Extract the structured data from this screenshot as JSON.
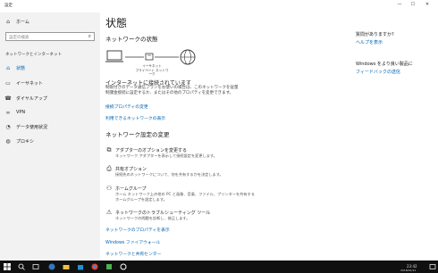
{
  "window": {
    "title": "設定",
    "min": "—",
    "max": "☐",
    "close": "✕"
  },
  "sidebar": {
    "home": "ホーム",
    "search_placeholder": "設定の検索",
    "section": "ネットワークとインターネット",
    "items": [
      {
        "label": "状態",
        "icon": "home-globe-icon"
      },
      {
        "label": "イーサネット",
        "icon": "ethernet-icon"
      },
      {
        "label": "ダイヤルアップ",
        "icon": "phone-icon"
      },
      {
        "label": "VPN",
        "icon": "vpn-icon"
      },
      {
        "label": "データ使用状況",
        "icon": "data-usage-icon"
      },
      {
        "label": "プロキシ",
        "icon": "globe-icon"
      }
    ]
  },
  "main": {
    "title": "状態",
    "network_status_heading": "ネットワークの状態",
    "diagram_label1": "イーサネット",
    "diagram_label2": "プライベート ネットワーク",
    "connected_heading": "インターネットに接続されています",
    "connected_desc1": "制限付きのデータ通信プランをお使いの場合は、このネットワークを従量",
    "connected_desc2": "制課金接続に設定するか、またはその他のプロパティを変更できます。",
    "link_change_props": "接続プロパティの変更",
    "link_show_networks": "利用できるネットワークの表示",
    "change_settings_heading": "ネットワーク設定の変更",
    "options": [
      {
        "title": "アダプターのオプションを変更する",
        "desc": "ネットワーク アダプターを表示して接続設定を変更します。",
        "icon": "adapter-icon"
      },
      {
        "title": "共有オプション",
        "desc": "接続先のネットワークについて、何を共有するかを決定します。",
        "icon": "sharing-icon"
      },
      {
        "title": "ホームグループ",
        "desc": "ホーム ネットワーク上の他の PC と画像、音楽、ファイル、プリンターを共有する",
        "desc2": "ホームグループを設定します。",
        "icon": "homegroup-icon"
      },
      {
        "title": "ネットワークのトラブルシューティング ツール",
        "desc": "ネットワークの問題を診断し、修正します。",
        "icon": "warning-icon"
      }
    ],
    "link_view_props": "ネットワークのプロパティを表示",
    "link_firewall": "Windows ファイアウォール",
    "link_sharing_center": "ネットワークと共有センター"
  },
  "right": {
    "question_heading": "質問がありますか?",
    "help_link": "ヘルプを表示",
    "improve_heading": "Windows をより良い製品に",
    "feedback_link": "フィードバックの送信"
  },
  "taskbar": {
    "time": "23:42",
    "date": "2018/01/11"
  }
}
